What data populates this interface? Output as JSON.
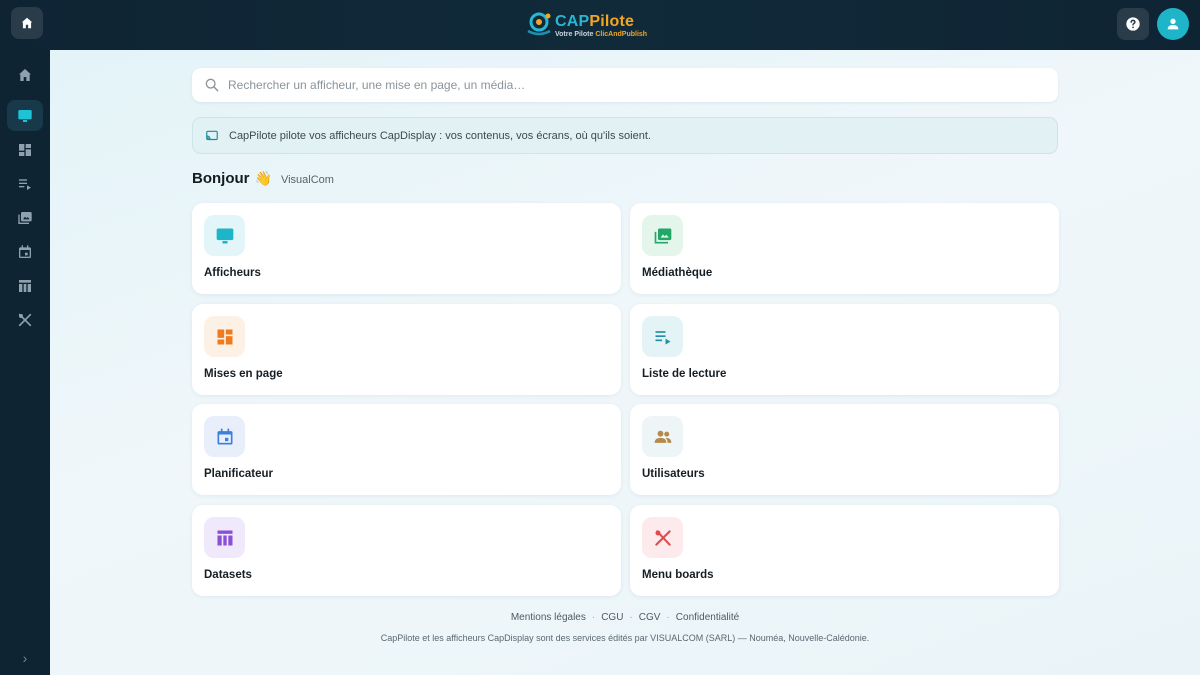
{
  "topbar": {
    "logo": {
      "brand_cap": "CAP",
      "brand_pilote": "Pilote",
      "subtitle_prefix": "Votre Pilote ",
      "subtitle_brand": "ClicAndPublish"
    },
    "home_icon": "home-icon",
    "help_icon": "help-icon",
    "avatar_icon": "user-icon"
  },
  "sidebar": {
    "items": [
      {
        "icon": "home-icon",
        "active": false
      },
      {
        "icon": "monitor-icon",
        "active": true
      },
      {
        "icon": "dashboard-icon",
        "active": false
      },
      {
        "icon": "playlist-icon",
        "active": false
      },
      {
        "icon": "media-library-icon",
        "active": false
      },
      {
        "icon": "calendar-icon",
        "active": false
      },
      {
        "icon": "table-icon",
        "active": false
      },
      {
        "icon": "utensils-icon",
        "active": false
      }
    ],
    "expand_icon": "›"
  },
  "search": {
    "placeholder": "Rechercher un afficheur, une mise en page, un média…",
    "value": ""
  },
  "banner": {
    "text": "CapPilote pilote vos afficheurs CapDisplay : vos contenus, vos écrans, où qu'ils soient."
  },
  "greeting": {
    "hello": "Bonjour",
    "wave": "👋",
    "org": "VisualCom"
  },
  "cards": [
    {
      "label": "Afficheurs",
      "icon": "monitor-icon",
      "color": "#1fb5c9",
      "bg": "#e2f6f9"
    },
    {
      "label": "Médiathèque",
      "icon": "media-library-icon",
      "color": "#22a866",
      "bg": "#e4f6ec"
    },
    {
      "label": "Mises en page",
      "icon": "dashboard-icon",
      "color": "#f07a1e",
      "bg": "#fdf0e4"
    },
    {
      "label": "Liste de lecture",
      "icon": "playlist-icon",
      "color": "#2190a4",
      "bg": "#e4f3f6"
    },
    {
      "label": "Planificateur",
      "icon": "calendar-icon",
      "color": "#3d7fe0",
      "bg": "#e8effb"
    },
    {
      "label": "Utilisateurs",
      "icon": "users-icon",
      "color": "#b38a49",
      "bg": "#eef5f7"
    },
    {
      "label": "Datasets",
      "icon": "table-icon",
      "color": "#8a4fd6",
      "bg": "#efe9fb"
    },
    {
      "label": "Menu boards",
      "icon": "utensils-icon",
      "color": "#e5474f",
      "bg": "#fdeaec"
    }
  ],
  "footer": {
    "links": [
      "Mentions légales",
      "CGU",
      "CGV",
      "Confidentialité"
    ],
    "separator": "·",
    "copyright": "CapPilote et les afficheurs CapDisplay sont des services édités par VISUALCOM (SARL) — Nouméa, Nouvelle-Calédonie."
  }
}
